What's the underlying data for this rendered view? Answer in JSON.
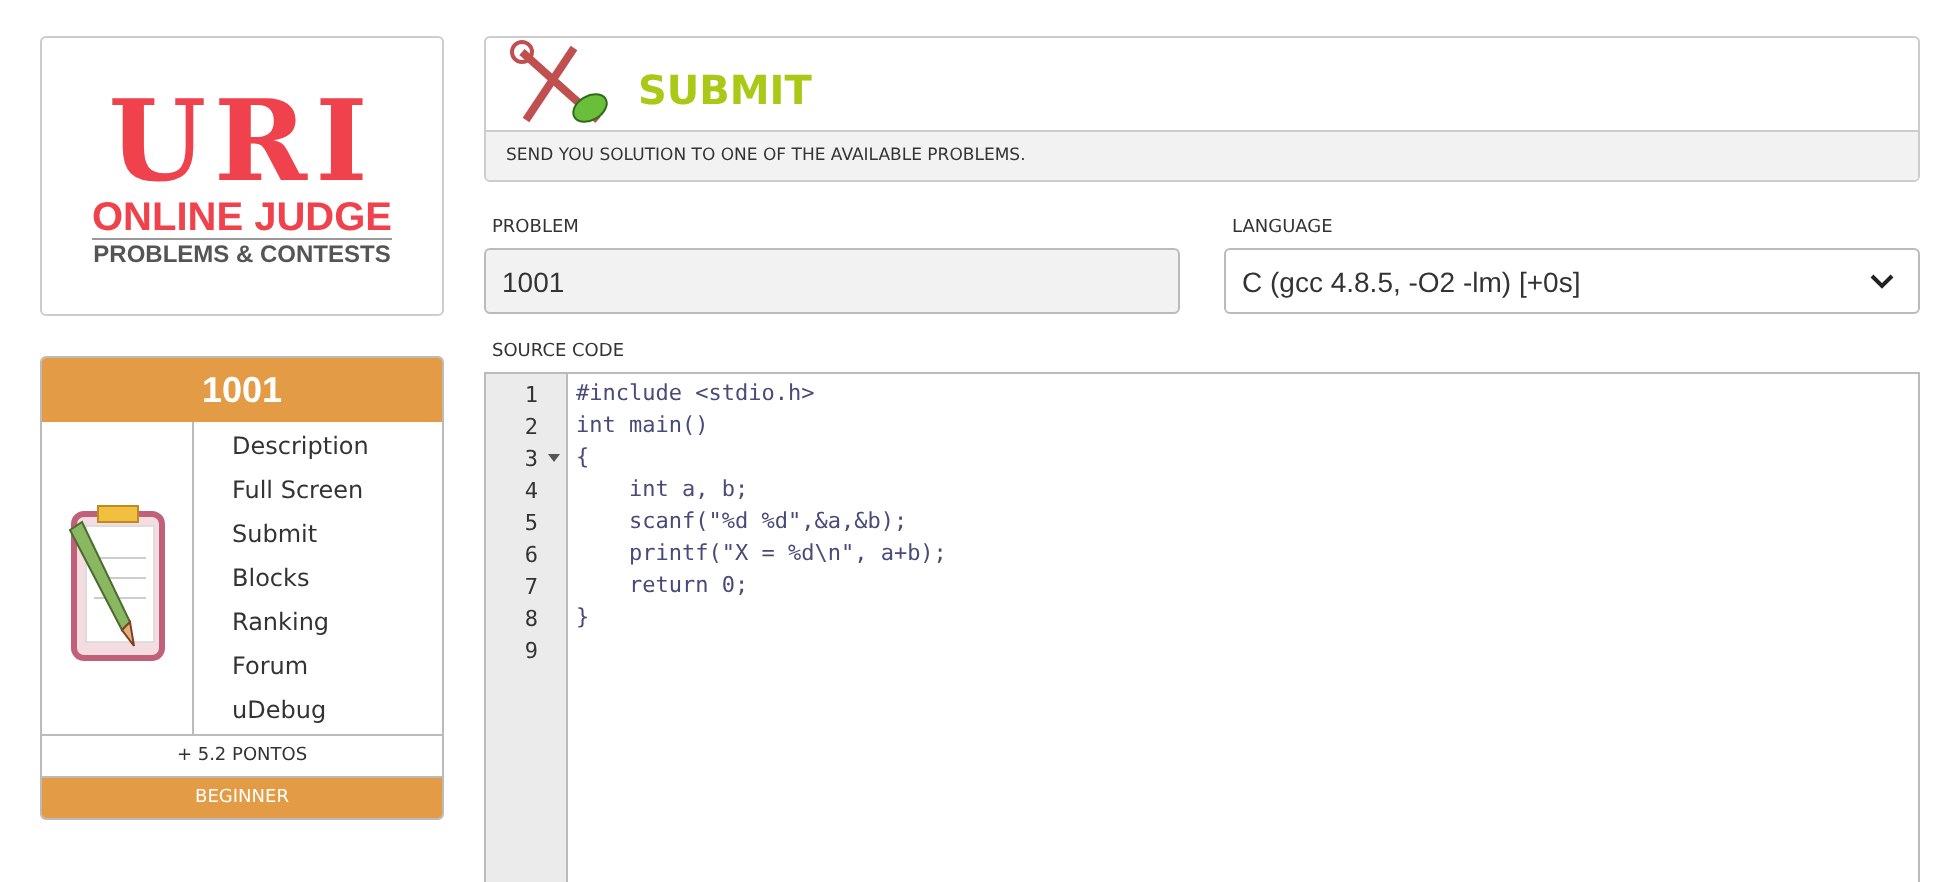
{
  "logo": {
    "title": "URI",
    "subtitle": "ONLINE JUDGE",
    "tagline": "PROBLEMS & CONTESTS"
  },
  "problem_card": {
    "title": "1001",
    "menu": [
      "Description",
      "Full Screen",
      "Submit",
      "Blocks",
      "Ranking",
      "Forum",
      "uDebug"
    ],
    "points": "+ 5.2 PONTOS",
    "level_label": "BEGINNER"
  },
  "header": {
    "title": "SUBMIT",
    "description": "SEND YOU SOLUTION TO ONE OF THE AVAILABLE PROBLEMS."
  },
  "problem_field": {
    "label": "PROBLEM",
    "value": "1001"
  },
  "language_field": {
    "label": "LANGUAGE",
    "value": "C (gcc 4.8.5, -O2 -lm) [+0s]"
  },
  "source_code": {
    "label": "SOURCE CODE",
    "lines": [
      {
        "number": "1",
        "text": "#include <stdio.h>",
        "foldable": false
      },
      {
        "number": "2",
        "text": "int main()",
        "foldable": false
      },
      {
        "number": "3",
        "text": "{",
        "foldable": true
      },
      {
        "number": "4",
        "text": "    int a, b;",
        "foldable": false
      },
      {
        "number": "5",
        "text": "    scanf(\"%d %d\",&a,&b);",
        "foldable": false
      },
      {
        "number": "6",
        "text": "    printf(\"X = %d\\n\", a+b);",
        "foldable": false
      },
      {
        "number": "7",
        "text": "    return 0;",
        "foldable": false
      },
      {
        "number": "8",
        "text": "}",
        "foldable": false
      },
      {
        "number": "9",
        "foldable": false
      }
    ]
  }
}
